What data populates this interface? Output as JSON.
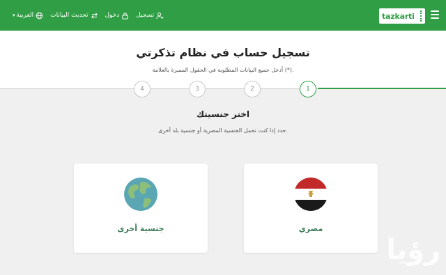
{
  "header": {
    "logo_text": "tazkarti",
    "nav": {
      "register": "تسجيل",
      "login": "دخول",
      "update_data": "تحديث البيانات",
      "language": "العربية"
    }
  },
  "page": {
    "title": "تسجيل حساب في نظام تذكرتي",
    "subtitle": "أدخل جميع البيانات المطلوبة في الحقول المميزة بالعلامة (*)."
  },
  "steps": [
    {
      "label": "1",
      "active": true
    },
    {
      "label": "2",
      "active": false
    },
    {
      "label": "3",
      "active": false
    },
    {
      "label": "4",
      "active": false
    }
  ],
  "section": {
    "title": "اختر جنسيتك",
    "subtitle": "حدد إذا كنت تحمل الجنسية المصرية أو جنسية بلد أخرى."
  },
  "options": {
    "egyptian": {
      "label": "مصري",
      "icon": "egypt-flag-icon"
    },
    "other": {
      "label": "جنسية أخرى",
      "icon": "globe-icon"
    }
  },
  "watermark": "رؤيا",
  "colors": {
    "brand": "#2f9e44",
    "option_label": "#3a7a55"
  }
}
